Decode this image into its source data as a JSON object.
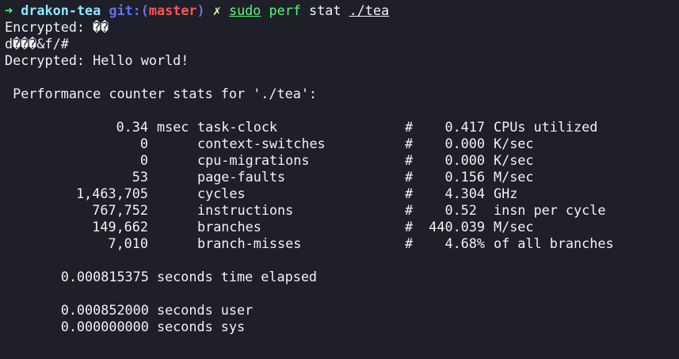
{
  "prompt": {
    "arrow": "➜",
    "dir": "drakon-tea",
    "git_prefix": "git:(",
    "branch": "master",
    "git_suffix": ")",
    "dirty_mark": "✗",
    "sudo": "sudo",
    "cmd": "perf",
    "sub": "stat",
    "arg": "./tea"
  },
  "output": {
    "encrypted": "Encrypted: ��",
    "garbled": "d���&f/#",
    "decrypted": "Decrypted: Hello world!",
    "header": " Performance counter stats for './tea':"
  },
  "stats": [
    {
      "value": "0.34",
      "unit": "msec",
      "event": "task-clock",
      "hash": "#",
      "metric_value": "0.417",
      "metric_unit": "CPUs utilized"
    },
    {
      "value": "0",
      "unit": "",
      "event": "context-switches",
      "hash": "#",
      "metric_value": "0.000",
      "metric_unit": "K/sec"
    },
    {
      "value": "0",
      "unit": "",
      "event": "cpu-migrations",
      "hash": "#",
      "metric_value": "0.000",
      "metric_unit": "K/sec"
    },
    {
      "value": "53",
      "unit": "",
      "event": "page-faults",
      "hash": "#",
      "metric_value": "0.156",
      "metric_unit": "M/sec"
    },
    {
      "value": "1,463,705",
      "unit": "",
      "event": "cycles",
      "hash": "#",
      "metric_value": "4.304",
      "metric_unit": "GHz"
    },
    {
      "value": "767,752",
      "unit": "",
      "event": "instructions",
      "hash": "#",
      "metric_value": "0.52 ",
      "metric_unit": "insn per cycle"
    },
    {
      "value": "149,662",
      "unit": "",
      "event": "branches",
      "hash": "#",
      "metric_value": "440.039",
      "metric_unit": "M/sec"
    },
    {
      "value": "7,010",
      "unit": "",
      "event": "branch-misses",
      "hash": "#",
      "metric_value": "4.68%",
      "metric_unit": "of all branches"
    }
  ],
  "timing": {
    "elapsed": "       0.000815375 seconds time elapsed",
    "user": "       0.000852000 seconds user",
    "sys": "       0.000000000 seconds sys"
  }
}
